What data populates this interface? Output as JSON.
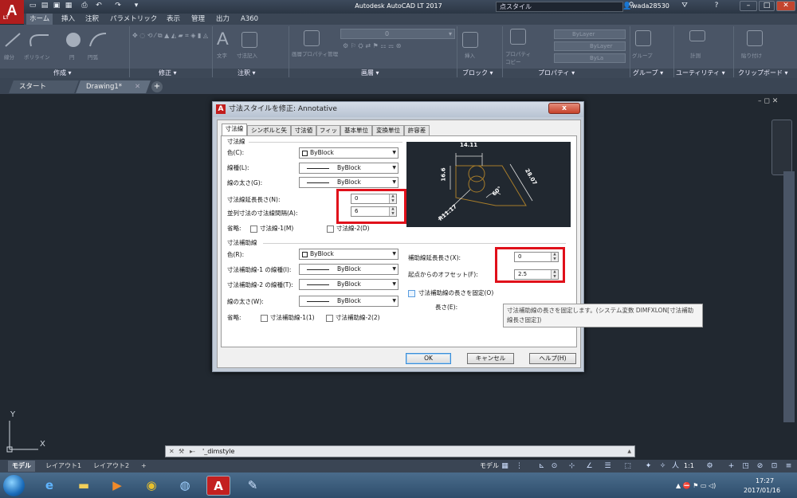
{
  "title_bar": {
    "app_title": "Autodesk AutoCAD LT 2017",
    "app_button_letter": "A",
    "app_button_sub": "LT",
    "search_text": "点スタイル",
    "user_name": "wada28530"
  },
  "ribbon": {
    "tabs": [
      "ホーム",
      "挿入",
      "注釈",
      "パラメトリック",
      "表示",
      "管理",
      "出力",
      "A360"
    ],
    "panels": [
      "作成",
      "修正",
      "注釈",
      "画層",
      "ブロック",
      "プロパティ",
      "グループ",
      "ユーティリティ",
      "クリップボード"
    ],
    "tools": {
      "line": "線分",
      "polyline": "ポリライン",
      "circle": "円",
      "arc": "円弧",
      "text": "文字",
      "dimension": "寸法記入",
      "layer_properties": "画層プロパティ管理",
      "insert": "挿入",
      "properties_copy": "プロパティコピー",
      "group": "グループ",
      "measure": "計測",
      "paste": "貼り付け"
    },
    "layer_current": "0",
    "bylayer_values": [
      "ByLayer",
      "ByLayer",
      "ByLa"
    ]
  },
  "doc_tabs": [
    "スタート",
    "Drawing1*"
  ],
  "dialog": {
    "title": "寸法スタイルを修正: Annotative",
    "close_label": "x",
    "tabs": [
      "寸法線",
      "シンボルと矢印",
      "寸法値",
      "フィット",
      "基本単位",
      "変換単位",
      "許容差"
    ],
    "dim_lines": {
      "group_title": "寸法線",
      "color_label": "色(C):",
      "color_value": "ByBlock",
      "linetype_label": "線種(L):",
      "linetype_value": "ByBlock",
      "lineweight_label": "線の太さ(G):",
      "lineweight_value": "ByBlock",
      "extend_label": "寸法線延長長さ(N):",
      "extend_value": "0",
      "baseline_label": "並列寸法の寸法線間隔(A):",
      "baseline_value": "6",
      "suppress_label": "省略:",
      "suppress_1": "寸法線-1(M)",
      "suppress_2": "寸法線-2(D)"
    },
    "ext_lines": {
      "group_title": "寸法補助線",
      "color_label": "色(R):",
      "color_value": "ByBlock",
      "linetype1_label": "寸法補助線-1 の線種(I):",
      "linetype1_value": "ByBlock",
      "linetype2_label": "寸法補助線-2 の線種(T):",
      "linetype2_value": "ByBlock",
      "lineweight_label": "線の太さ(W):",
      "lineweight_value": "ByBlock",
      "suppress_label": "省略:",
      "suppress_1": "寸法補助線-1(1)",
      "suppress_2": "寸法補助線-2(2)",
      "extend_beyond_label": "補助線延長長さ(X):",
      "extend_beyond_value": "0",
      "offset_label": "起点からのオフセット(F):",
      "offset_value": "2.5",
      "fixed_length_label": "寸法補助線の長さを固定(O)",
      "length_label": "長さ(E):"
    },
    "preview": {
      "dim_top": "14.11",
      "dim_left": "16.6",
      "dim_right": "28.07",
      "dim_angle": "60°",
      "dim_radius": "R11.17"
    },
    "tooltip": "寸法補助線の長さを固定します。(システム変数 DIMFXLON[寸法補助線長さ固定])",
    "buttons": {
      "ok": "OK",
      "cancel": "キャンセル",
      "help": "ヘルプ(H)"
    }
  },
  "command_line": {
    "text": "'_dimstyle"
  },
  "ucs": {
    "y": "Y",
    "x": "X"
  },
  "layout_tabs": [
    "モデル",
    "レイアウト1",
    "レイアウト2"
  ],
  "status_bar": {
    "model_label": "モデル",
    "scale": "1:1"
  },
  "taskbar": {
    "clock_time": "17:27",
    "clock_date": "2017/01/16"
  }
}
